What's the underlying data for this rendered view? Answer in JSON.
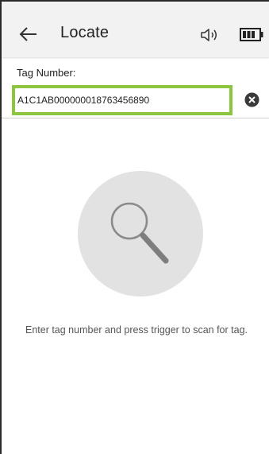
{
  "header": {
    "title": "Locate",
    "icons": {
      "back": "arrow-left-icon",
      "sound": "speaker-icon",
      "battery": "battery-icon"
    }
  },
  "tag_field": {
    "label": "Tag Number:",
    "value": "A1C1AB000000018763456890",
    "clear_icon": "clear-icon"
  },
  "empty_state": {
    "icon": "search-icon",
    "hint": "Enter tag number and press trigger to scan for tag."
  },
  "colors": {
    "app_bar": "#f2f2f2",
    "input_highlight": "#8cc63f",
    "icon_circle": "#e2e2e2",
    "hint_text": "#555555"
  }
}
